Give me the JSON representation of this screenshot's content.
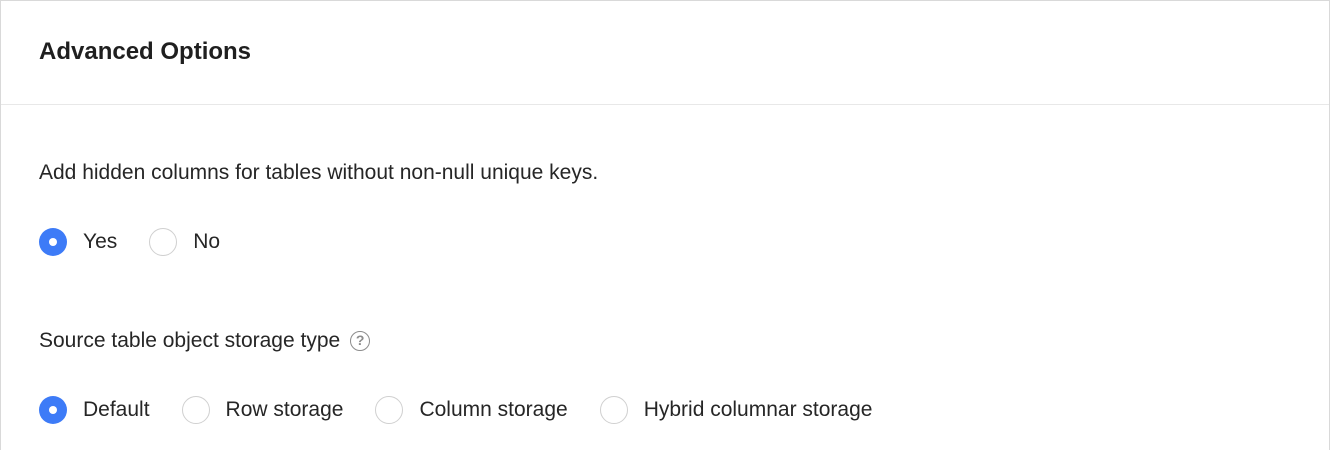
{
  "section": {
    "title": "Advanced Options"
  },
  "hidden_columns": {
    "label": "Add hidden columns for tables without non-null unique keys.",
    "options": [
      {
        "label": "Yes",
        "checked": true
      },
      {
        "label": "No",
        "checked": false
      }
    ]
  },
  "storage_type": {
    "label": "Source table object storage type",
    "help_icon": "?",
    "options": [
      {
        "label": "Default",
        "checked": true
      },
      {
        "label": "Row storage",
        "checked": false
      },
      {
        "label": "Column storage",
        "checked": false
      },
      {
        "label": "Hybrid columnar storage",
        "checked": false
      }
    ]
  },
  "colors": {
    "accent": "#3d7bf7",
    "border": "#d9d9d9"
  }
}
